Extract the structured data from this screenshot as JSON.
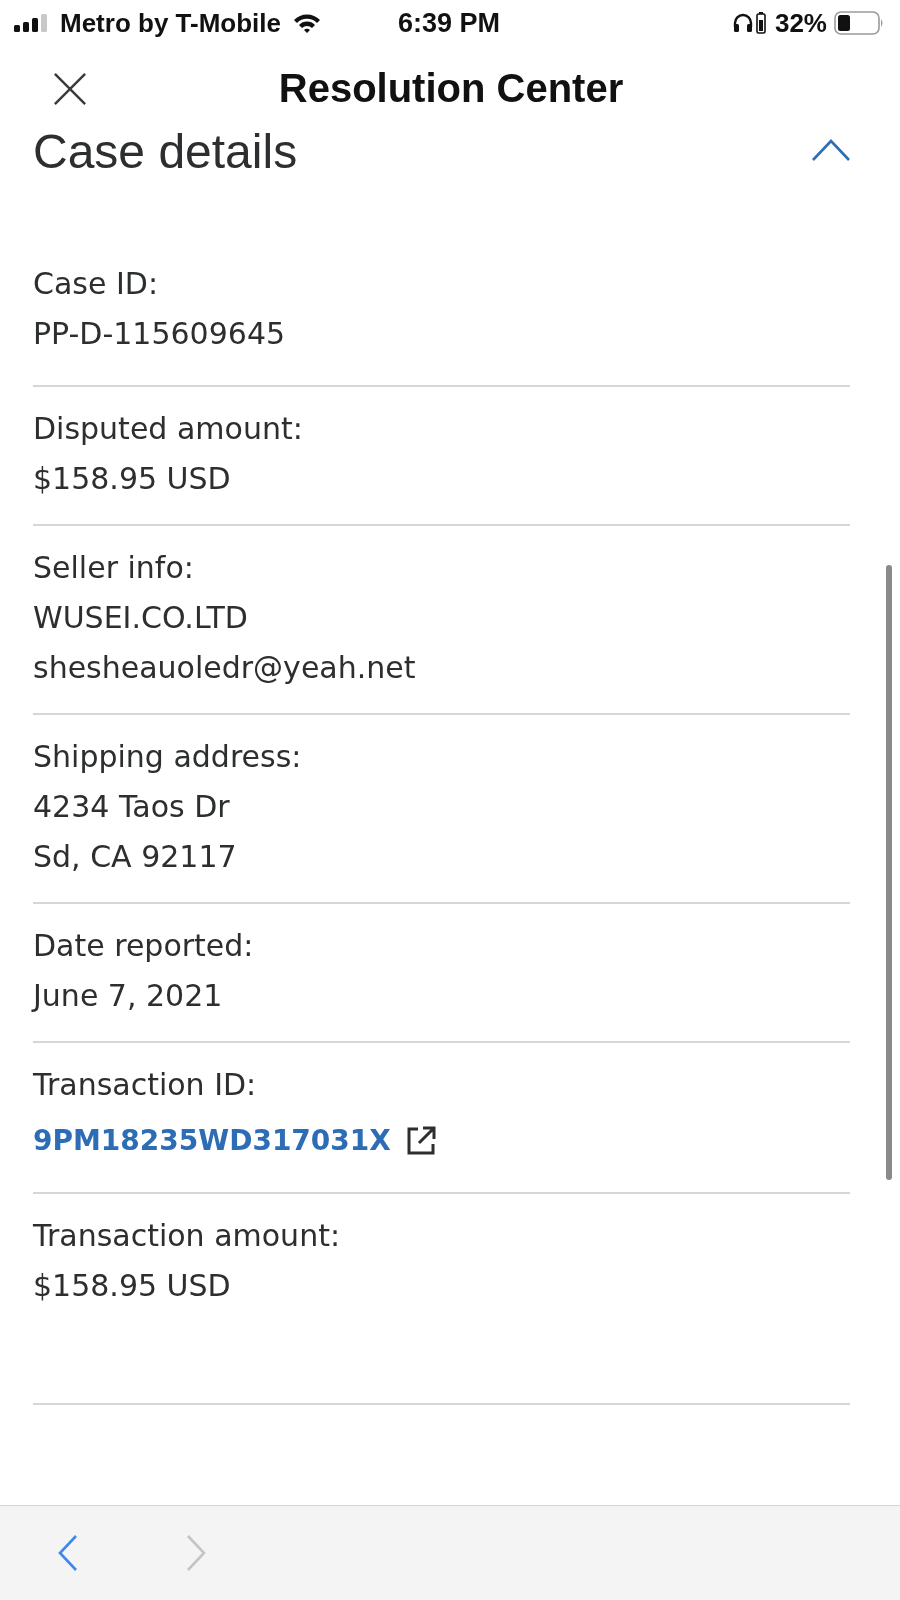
{
  "status_bar": {
    "carrier": "Metro by T-Mobile",
    "time": "6:39 PM",
    "battery": "32%"
  },
  "header": {
    "title": "Resolution Center"
  },
  "section": {
    "title": "Case details",
    "expanded": true
  },
  "details": [
    {
      "kind": "text",
      "label": "Case ID:",
      "lines": [
        "PP-D-115609645"
      ]
    },
    {
      "kind": "text",
      "label": "Disputed amount:",
      "lines": [
        "$158.95 USD"
      ]
    },
    {
      "kind": "text",
      "label": "Seller info:",
      "lines": [
        "WUSEI.CO.LTD",
        "shesheauoledr@yeah.net"
      ]
    },
    {
      "kind": "text",
      "label": "Shipping address:",
      "lines": [
        "4234 Taos Dr",
        "Sd, CA 92117"
      ]
    },
    {
      "kind": "text",
      "label": "Date reported:",
      "lines": [
        "June 7, 2021"
      ]
    },
    {
      "kind": "link",
      "label": "Transaction ID:",
      "lines": [
        "9PM18235WD317031X"
      ]
    },
    {
      "kind": "text",
      "label": "Transaction amount:",
      "lines": [
        "$158.95 USD"
      ]
    }
  ],
  "toolbar": [
    {
      "kind": "back",
      "disabled": false
    },
    {
      "kind": "forward",
      "disabled": true
    }
  ]
}
